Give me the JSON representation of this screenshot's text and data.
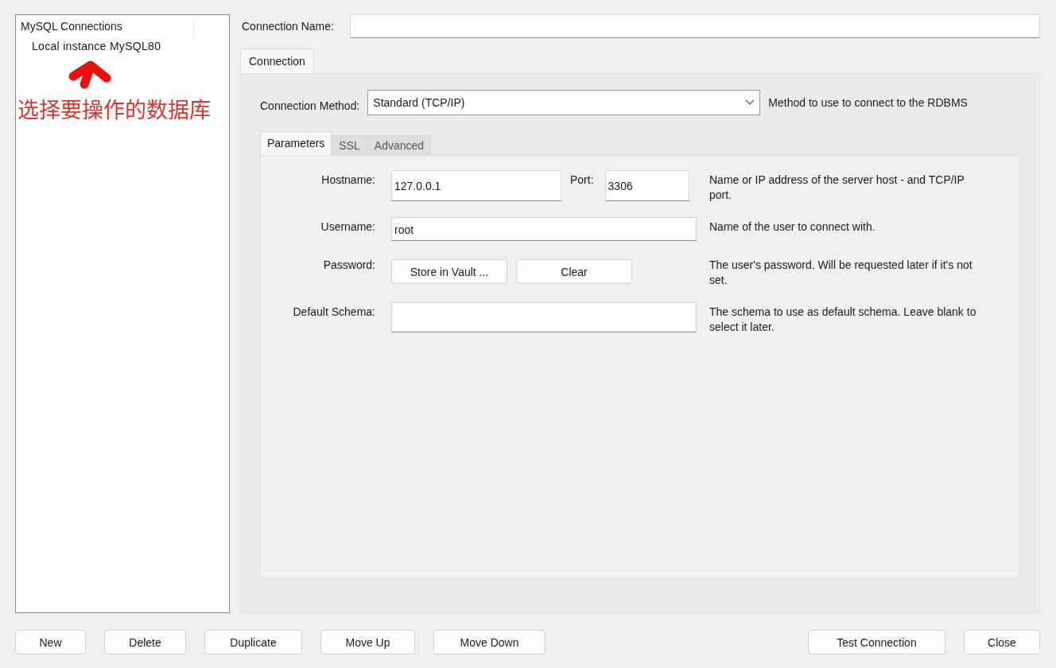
{
  "sidebar": {
    "header": "MySQL Connections",
    "items": [
      {
        "label": "Local instance MySQL80",
        "selected": false
      }
    ]
  },
  "annotation": {
    "text": "选择要操作的数据库"
  },
  "connection_name": {
    "label": "Connection Name:"
  },
  "tabs": [
    {
      "label": "Connection",
      "selected": true
    }
  ],
  "connection_method": {
    "label": "Connection Method:",
    "value": "Standard (TCP/IP)",
    "description": "Method to use to connect to the RDBMS"
  },
  "inner_tabs": [
    {
      "label": "Parameters",
      "selected": true
    },
    {
      "label": "SSL",
      "selected": false
    },
    {
      "label": "Advanced",
      "selected": false
    }
  ],
  "hostname": {
    "label": "Hostname:",
    "value": "127.0.0.1",
    "port_label": "Port:",
    "port_value": "3306",
    "description": "Name or IP address of the server host - and TCP/IP port."
  },
  "username": {
    "label": "Username:",
    "value": "root",
    "description": "Name of the user to connect with."
  },
  "password": {
    "label": "Password:",
    "buttons": [
      "Store in Vault ...",
      "Clear"
    ],
    "description": "The user's password. Will be requested later if it's not set."
  },
  "default_schema": {
    "label": "Default Schema:",
    "description": "The schema to use as default schema. Leave blank to select it later."
  },
  "buttons_left": [
    "New",
    "Delete",
    "Duplicate",
    "Move Up",
    "Move Down"
  ],
  "buttons_right": [
    "Test Connection",
    "Close"
  ]
}
